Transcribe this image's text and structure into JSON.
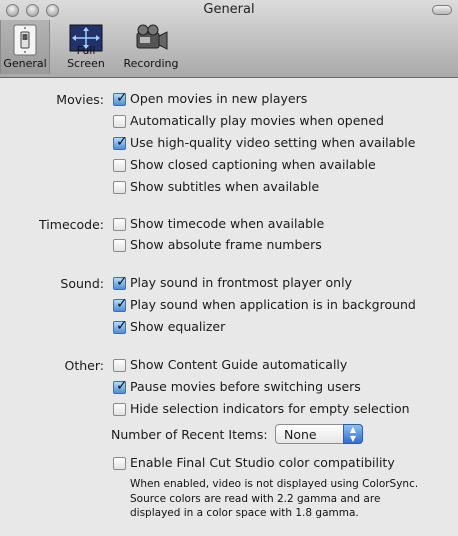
{
  "window": {
    "title": "General"
  },
  "toolbar": {
    "tabs": [
      {
        "label": "General",
        "icon": "light-switch-icon",
        "selected": true
      },
      {
        "label": "Full Screen",
        "icon": "full-screen-arrows-icon",
        "selected": false
      },
      {
        "label": "Recording",
        "icon": "video-camera-icon",
        "selected": false
      }
    ]
  },
  "sections": {
    "movies": {
      "label": "Movies:",
      "options": [
        {
          "label": "Open movies in new players",
          "checked": true
        },
        {
          "label": "Automatically play movies when opened",
          "checked": false
        },
        {
          "label": "Use high-quality video setting when available",
          "checked": true
        },
        {
          "label": "Show closed captioning when available",
          "checked": false
        },
        {
          "label": "Show subtitles when available",
          "checked": false
        }
      ]
    },
    "timecode": {
      "label": "Timecode:",
      "options": [
        {
          "label": "Show timecode when available",
          "checked": false
        },
        {
          "label": "Show absolute frame numbers",
          "checked": false
        }
      ]
    },
    "sound": {
      "label": "Sound:",
      "options": [
        {
          "label": "Play sound in frontmost player only",
          "checked": true
        },
        {
          "label": "Play sound when application is in background",
          "checked": true
        },
        {
          "label": "Show equalizer",
          "checked": true
        }
      ]
    },
    "other": {
      "label": "Other:",
      "options": [
        {
          "label": "Show Content Guide automatically",
          "checked": false
        },
        {
          "label": "Pause movies before switching users",
          "checked": true
        },
        {
          "label": "Hide selection indicators for empty selection",
          "checked": false
        }
      ],
      "recent_items": {
        "label": "Number of Recent Items:",
        "value": "None"
      },
      "colorsync": {
        "label": "Enable Final Cut Studio color compatibility",
        "checked": false,
        "note": "When enabled, video is not displayed using ColorSync.\nSource colors are read with 2.2 gamma and are\ndisplayed in a color space with 1.8 gamma."
      }
    }
  },
  "colors": {
    "checkbox_accent": "#4d8ed8",
    "window_bg": "#e8e8e8"
  }
}
